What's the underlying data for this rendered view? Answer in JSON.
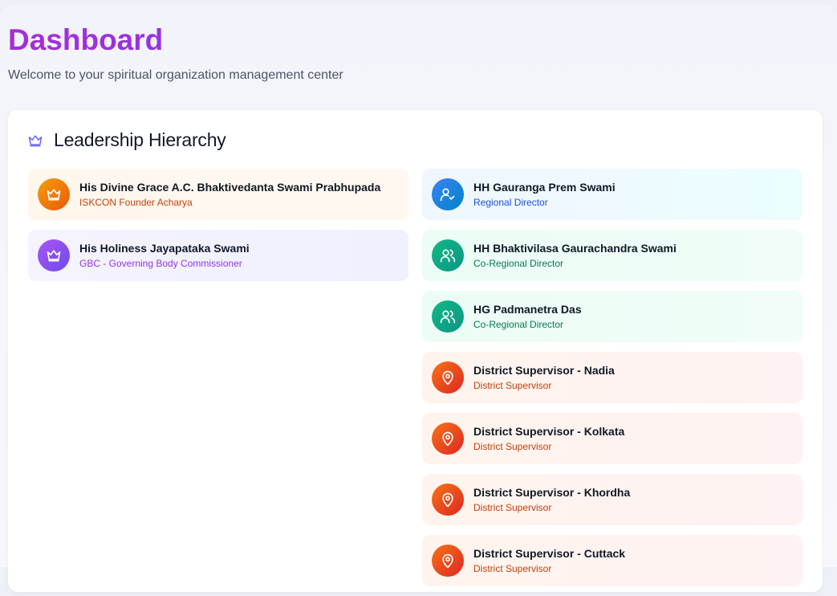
{
  "header": {
    "title": "Dashboard",
    "subtitle": "Welcome to your spiritual organization management center"
  },
  "leadership": {
    "title": "Leadership Hierarchy",
    "icon": "crown-icon",
    "left": [
      {
        "name": "His Divine Grace A.C. Bhaktivedanta Swami Prabhupada",
        "role": "ISKCON Founder Acharya",
        "icon": "crown-icon",
        "color": "#ea580c"
      },
      {
        "name": "His Holiness Jayapataka Swami",
        "role": "GBC - Governing Body Commissioner",
        "icon": "crown-icon",
        "color": "#7c3aed"
      }
    ],
    "right": [
      {
        "name": "HH Gauranga Prem Swami",
        "role": "Regional Director",
        "icon": "user-check-icon",
        "color": "#2563eb"
      },
      {
        "name": "HH Bhaktivilasa Gaurachandra Swami",
        "role": "Co-Regional Director",
        "icon": "users-icon",
        "color": "#059669"
      },
      {
        "name": "HG Padmanetra Das",
        "role": "Co-Regional Director",
        "icon": "users-icon",
        "color": "#059669"
      },
      {
        "name": "District Supervisor - Nadia",
        "role": "District Supervisor",
        "icon": "map-pin-icon",
        "color": "#ea580c"
      },
      {
        "name": "District Supervisor - Kolkata",
        "role": "District Supervisor",
        "icon": "map-pin-icon",
        "color": "#ea580c"
      },
      {
        "name": "District Supervisor - Khordha",
        "role": "District Supervisor",
        "icon": "map-pin-icon",
        "color": "#ea580c"
      },
      {
        "name": "District Supervisor - Cuttack",
        "role": "District Supervisor",
        "icon": "map-pin-icon",
        "color": "#ea580c"
      }
    ]
  }
}
